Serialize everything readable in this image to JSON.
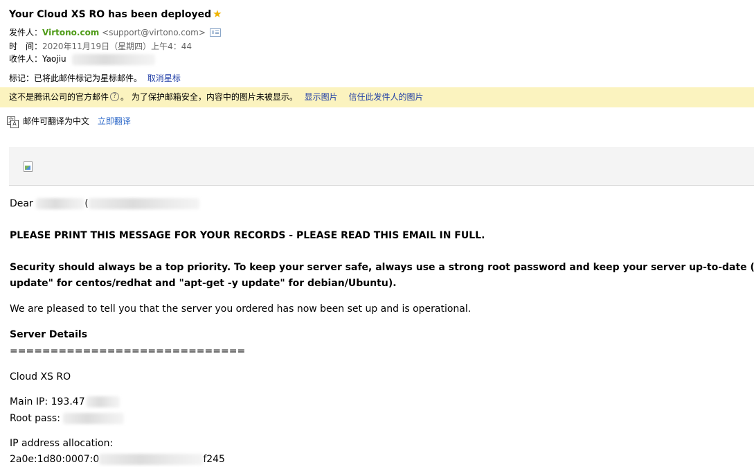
{
  "email": {
    "subject": "Your Cloud XS RO has been deployed",
    "from_label": "发件人：",
    "from_name": "Virtono.com",
    "from_address": "<support@virtono.com>",
    "time_label": "时　间：",
    "time_value": "2020年11月19日（星期四）上午4：44",
    "to_label": "收件人：",
    "to_value": "Yaojiu",
    "mark_label": "标记：",
    "mark_text": "已将此邮件标记为星标邮件。",
    "mark_cancel": "取消星标"
  },
  "warning": {
    "text_before": "这不是腾讯公司的官方邮件",
    "question_glyph": "?",
    "text_after": "。 为了保护邮箱安全，内容中的图片未被显示。",
    "show_images": "显示图片",
    "trust_sender": "信任此发件人的图片"
  },
  "translate": {
    "text": "邮件可翻译为中文",
    "action": "立即翻译"
  },
  "body": {
    "greeting": "Dear",
    "greeting_tail": "(",
    "print_notice": "PLEASE PRINT THIS MESSAGE FOR YOUR RECORDS - PLEASE READ THIS EMAIL IN FULL.",
    "security_line1": "Security should always be a top priority. To keep your server safe, always use a strong root password and keep your server up-to-date (",
    "security_line2": "update\" for centos/redhat and \"apt-get -y update\" for debian/Ubuntu).",
    "pleased": "We are pleased to tell you that the server you ordered has now been set up and is operational.",
    "details_heading": "Server Details",
    "separator": "=============================",
    "product": "Cloud XS RO",
    "main_ip": "Main IP: 193.47",
    "root_pass": "Root pass:",
    "ip_alloc_label": "IP address allocation:",
    "ipv6_start": "2a0e:1d80:0007:0",
    "ipv6_end": "f245"
  }
}
